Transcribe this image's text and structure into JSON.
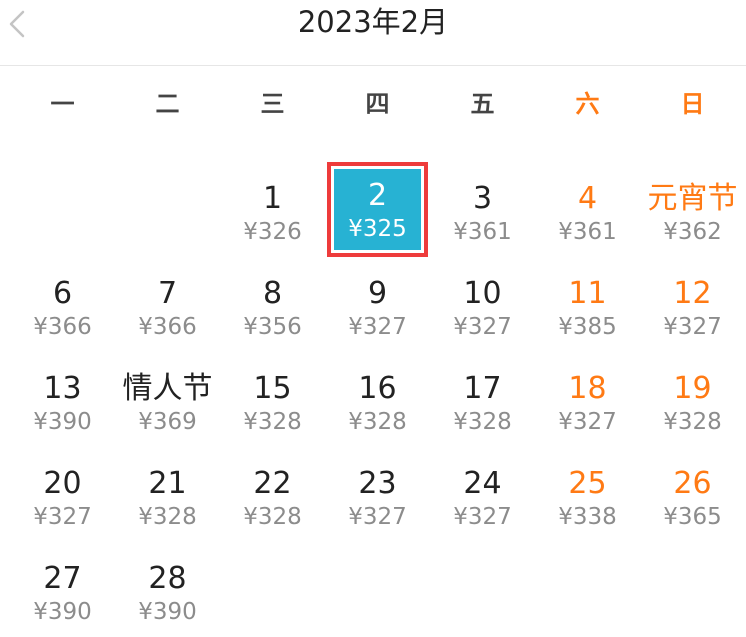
{
  "header": {
    "title": "2023年2月",
    "back_icon": "chevron-left-icon"
  },
  "weekdays": [
    "一",
    "二",
    "三",
    "四",
    "五",
    "六",
    "日"
  ],
  "colors": {
    "weekend": "#ff7a14",
    "selected_bg": "#27b2d3",
    "selected_border": "#ee3b3b",
    "price": "#8c8c8c"
  },
  "selected_day": "2",
  "days": [
    {
      "day": "1",
      "price": "¥326"
    },
    {
      "day": "2",
      "price": "¥325"
    },
    {
      "day": "3",
      "price": "¥361"
    },
    {
      "day": "4",
      "price": "¥361"
    },
    {
      "day": "元宵节",
      "price": "¥362"
    },
    {
      "day": "6",
      "price": "¥366"
    },
    {
      "day": "7",
      "price": "¥366"
    },
    {
      "day": "8",
      "price": "¥356"
    },
    {
      "day": "9",
      "price": "¥327"
    },
    {
      "day": "10",
      "price": "¥327"
    },
    {
      "day": "11",
      "price": "¥385"
    },
    {
      "day": "12",
      "price": "¥327"
    },
    {
      "day": "13",
      "price": "¥390"
    },
    {
      "day": "情人节",
      "price": "¥369"
    },
    {
      "day": "15",
      "price": "¥328"
    },
    {
      "day": "16",
      "price": "¥328"
    },
    {
      "day": "17",
      "price": "¥328"
    },
    {
      "day": "18",
      "price": "¥327"
    },
    {
      "day": "19",
      "price": "¥328"
    },
    {
      "day": "20",
      "price": "¥327"
    },
    {
      "day": "21",
      "price": "¥328"
    },
    {
      "day": "22",
      "price": "¥328"
    },
    {
      "day": "23",
      "price": "¥327"
    },
    {
      "day": "24",
      "price": "¥327"
    },
    {
      "day": "25",
      "price": "¥338"
    },
    {
      "day": "26",
      "price": "¥365"
    },
    {
      "day": "27",
      "price": "¥390"
    },
    {
      "day": "28",
      "price": "¥390"
    }
  ]
}
